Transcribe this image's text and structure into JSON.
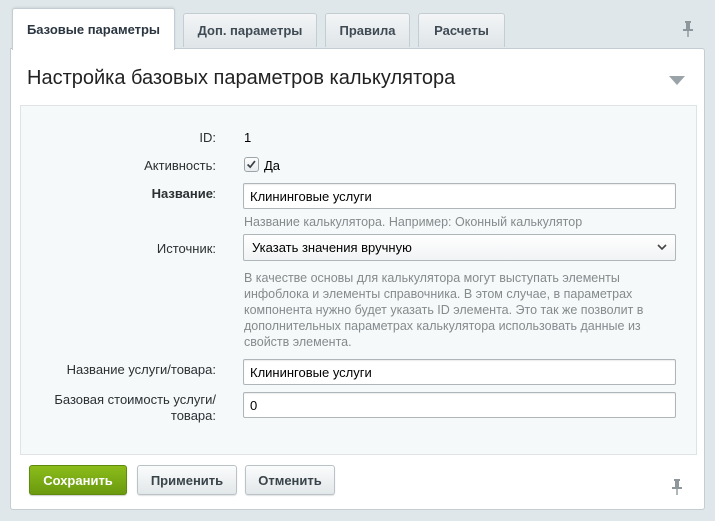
{
  "tabs": [
    {
      "label": "Базовые параметры",
      "active": true
    },
    {
      "label": "Доп. параметры",
      "active": false
    },
    {
      "label": "Правила",
      "active": false
    },
    {
      "label": "Расчеты",
      "active": false
    }
  ],
  "section": {
    "title": "Настройка базовых параметров калькулятора"
  },
  "form": {
    "id": {
      "label": "ID:",
      "value": "1"
    },
    "active": {
      "label": "Активность:",
      "checkbox_label": "Да",
      "checked": true
    },
    "name": {
      "label": "Название",
      "colon": ":",
      "value": "Клининговые услуги",
      "hint": "Название калькулятора. Например: Оконный калькулятор"
    },
    "source": {
      "label": "Источник:",
      "selected": "Указать значения вручную",
      "hint_lines": [
        "В качестве основы для калькулятора могут выступать элементы",
        "инфоблока и элементы справочника. В этом случае, в параметрах",
        "компонента нужно будет указать ID элемента. Это так же позволит в",
        "дополнительных параметрах калькулятора использовать данные из",
        "свойств элемента."
      ]
    },
    "product_name": {
      "label": "Название услуги/товара:",
      "value": "Клининговые услуги"
    },
    "base_price": {
      "label_line1": "Базовая стоимость услуги/",
      "label_line2": "товара:",
      "value": "0"
    }
  },
  "buttons": {
    "save": "Сохранить",
    "apply": "Применить",
    "cancel": "Отменить"
  },
  "icons": {
    "pin": "pin-icon",
    "collapse": "triangle-down-icon",
    "check": "checkmark-icon",
    "select": "chevron-down-icon"
  },
  "colors": {
    "save_button": "#7aab14",
    "background": "#e0e7ea",
    "form_box": "#f5f9f9"
  }
}
